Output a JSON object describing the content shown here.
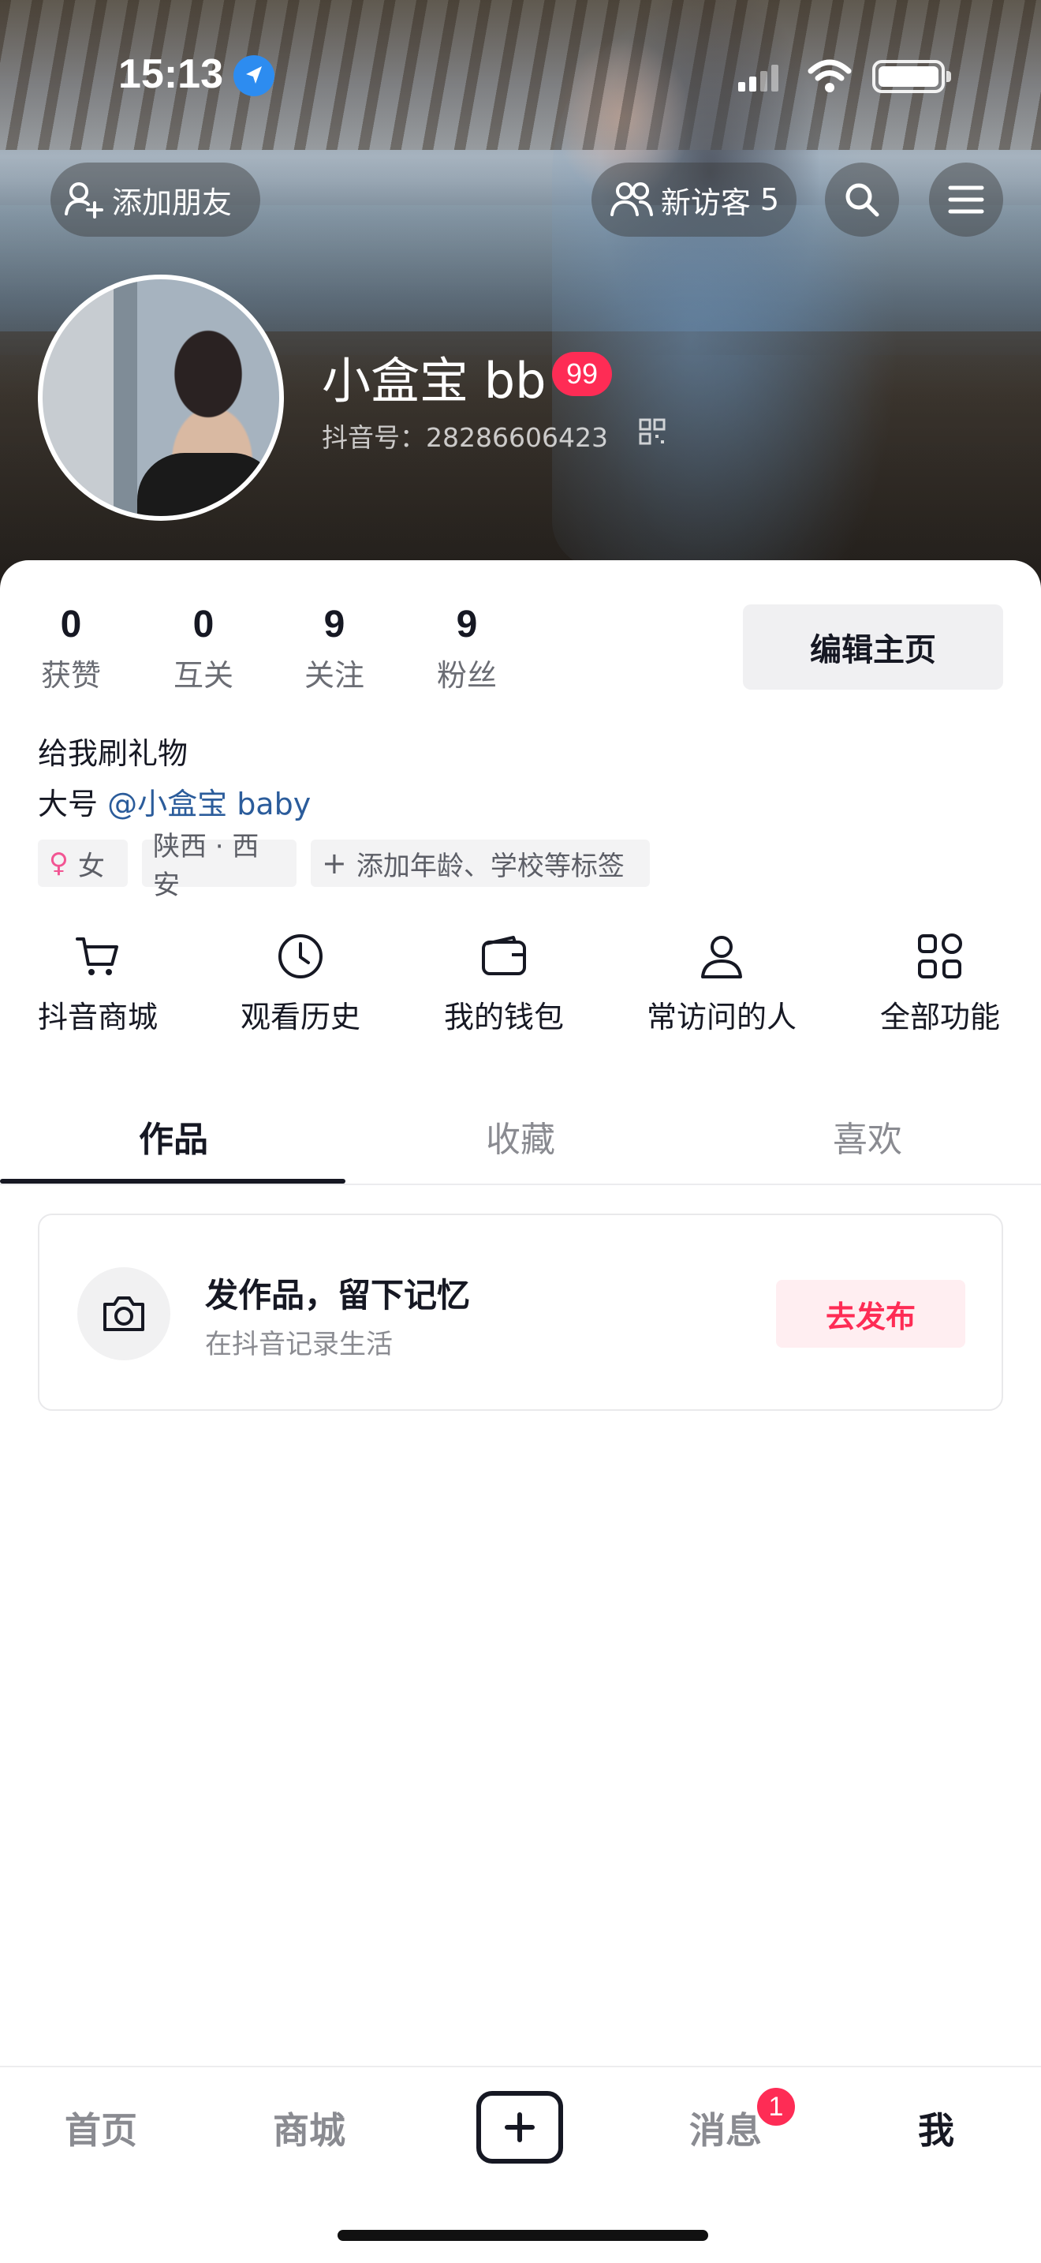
{
  "status_bar": {
    "time": "15:13"
  },
  "header": {
    "add_friend_label": "添加朋友",
    "visitors_label": "新访客",
    "visitors_count": "5"
  },
  "profile": {
    "name": "小盒宝 bb",
    "level": "99",
    "douyin_id": "抖音号：28286606423"
  },
  "stats": [
    {
      "value": "0",
      "label": "获赞"
    },
    {
      "value": "0",
      "label": "互关"
    },
    {
      "value": "9",
      "label": "关注"
    },
    {
      "value": "9",
      "label": "粉丝"
    }
  ],
  "edit_profile_label": "编辑主页",
  "bio": {
    "line1": "给我刷礼物",
    "alt_prefix": "大号",
    "alt_mention": "@小盒宝 baby"
  },
  "tags": {
    "gender": "女",
    "location": "陕西 · 西安",
    "add": "添加年龄、学校等标签"
  },
  "shortcuts": [
    {
      "label": "抖音商城",
      "icon": "cart-icon"
    },
    {
      "label": "观看历史",
      "icon": "clock-icon"
    },
    {
      "label": "我的钱包",
      "icon": "wallet-icon"
    },
    {
      "label": "常访问的人",
      "icon": "person-icon"
    },
    {
      "label": "全部功能",
      "icon": "grid-icon"
    }
  ],
  "tabs": [
    {
      "label": "作品",
      "active": true
    },
    {
      "label": "收藏",
      "active": false
    },
    {
      "label": "喜欢",
      "active": false
    }
  ],
  "post_prompt": {
    "title": "发作品，留下记忆",
    "subtitle": "在抖音记录生活",
    "button": "去发布"
  },
  "bottom_nav": {
    "home": "首页",
    "mall": "商城",
    "messages": "消息",
    "messages_badge": "1",
    "me": "我"
  },
  "colors": {
    "accent": "#fe2c55",
    "text": "#161823",
    "muted": "#8a8b91",
    "mention": "#2b5c9b"
  }
}
